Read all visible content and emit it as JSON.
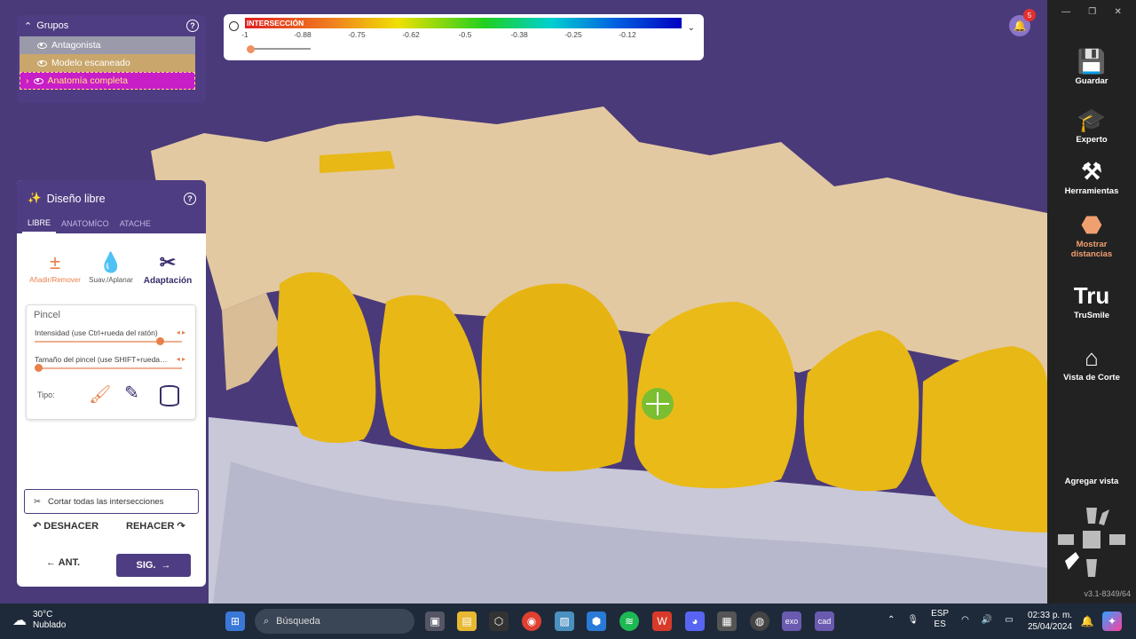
{
  "groups": {
    "title": "Grupos",
    "items": [
      {
        "label": "Antagonista",
        "bg": "#9a9aaa",
        "color": "#ffffff"
      },
      {
        "label": "Modelo escaneado",
        "bg": "#c9a66b",
        "color": "#ffffff"
      },
      {
        "label": "Anatomía completa",
        "bg": "#c81ec8",
        "color": "#ffe080"
      }
    ]
  },
  "notifications": {
    "count": "5"
  },
  "intersection": {
    "label": "INTERSECCIÓN",
    "ticks": [
      "-1",
      "-0.88",
      "-0.75",
      "-0.62",
      "-0.5",
      "-0.38",
      "-0.25",
      "-0.12"
    ],
    "slider_value": 0
  },
  "design": {
    "title": "Diseño libre",
    "tabs": [
      "LIBRE",
      "ANATOMÍCO",
      "ATACHE"
    ],
    "tools": [
      {
        "label": "Añadir/Remover",
        "icon": "add-remove-icon"
      },
      {
        "label": "Suav./Aplanar",
        "icon": "drop-icon"
      },
      {
        "label": "Adaptación",
        "icon": "scissors-icon"
      }
    ],
    "brush": {
      "title": "Pincel",
      "intensity_label": "Intensidad (use Ctrl+rueda del ratón)",
      "intensity_value": 0.85,
      "size_label": "Tamaño del pincel (use SHIFT+rueda del ratón)",
      "size_value": 0.0,
      "type_label": "Tipo:"
    },
    "cut_label": "Cortar todas las intersecciones",
    "undo_label": "DESHACER",
    "redo_label": "REHACER",
    "prev_label": "ANT.",
    "next_label": "SIG."
  },
  "sidebar": {
    "items": [
      {
        "label": "Guardar",
        "icon": "save-icon"
      },
      {
        "label": "Experto",
        "icon": "graduation-cap-icon"
      },
      {
        "label": "Herramientas",
        "icon": "tools-icon"
      },
      {
        "label": "Mostrar distancias",
        "icon": "distances-icon",
        "active": true
      },
      {
        "label": "TruSmile",
        "icon": "trusmile-icon"
      },
      {
        "label": "Vista de Corte",
        "icon": "cut-view-icon"
      }
    ],
    "add_view": "Agregar vista",
    "version": "v3.1-8349/64",
    "accent": "#f0a070"
  },
  "taskbar": {
    "temp": "30°C",
    "weather": "Nublado",
    "search_placeholder": "Búsqueda",
    "lang_top": "ESP",
    "lang_bottom": "ES",
    "time": "02:33 p. m.",
    "date": "25/04/2024"
  }
}
